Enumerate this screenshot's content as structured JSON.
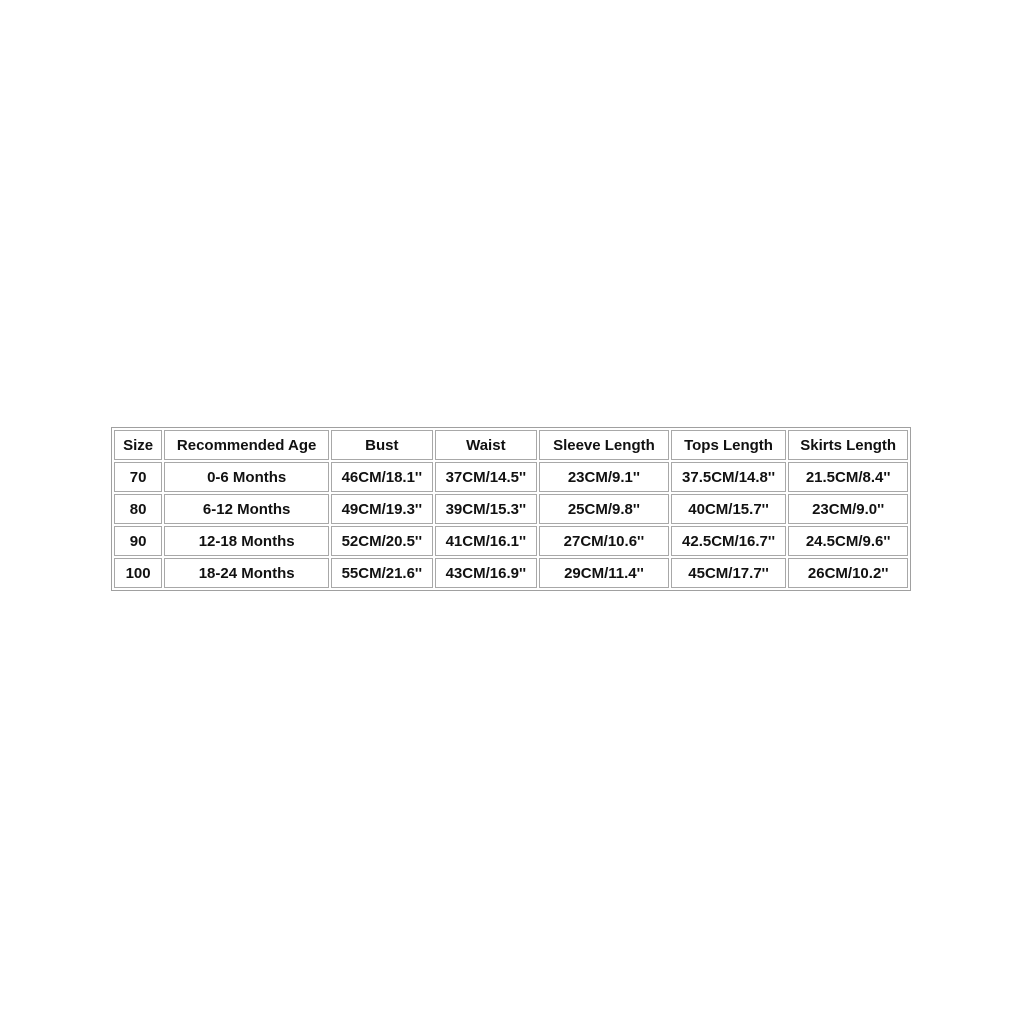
{
  "size_chart": {
    "headers": [
      "Size",
      "Recommended Age",
      "Bust",
      "Waist",
      "Sleeve Length",
      "Tops Length",
      "Skirts Length"
    ],
    "rows": [
      [
        "70",
        "0-6 Months",
        "46CM/18.1''",
        "37CM/14.5''",
        "23CM/9.1''",
        "37.5CM/14.8''",
        "21.5CM/8.4''"
      ],
      [
        "80",
        "6-12 Months",
        "49CM/19.3''",
        "39CM/15.3''",
        "25CM/9.8''",
        "40CM/15.7''",
        "23CM/9.0''"
      ],
      [
        "90",
        "12-18 Months",
        "52CM/20.5''",
        "41CM/16.1''",
        "27CM/10.6''",
        "42.5CM/16.7''",
        "24.5CM/9.6''"
      ],
      [
        "100",
        "18-24 Months",
        "55CM/21.6''",
        "43CM/16.9''",
        "29CM/11.4''",
        "45CM/17.7''",
        "26CM/10.2''"
      ]
    ]
  }
}
